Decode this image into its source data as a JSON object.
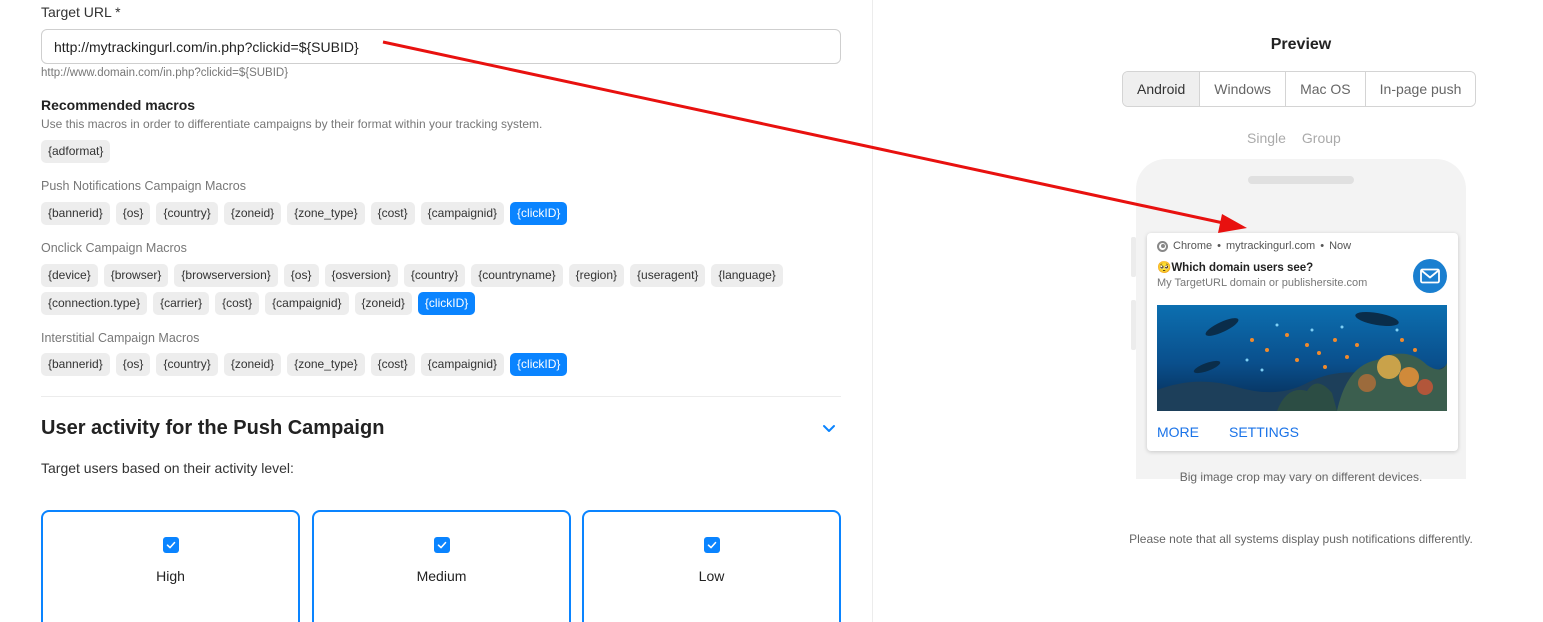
{
  "target_url": {
    "label": "Target URL *",
    "value": "http://mytrackingurl.com/in.php?clickid=${SUBID}",
    "hint": "http://www.domain.com/in.php?clickid=${SUBID}"
  },
  "recommended": {
    "title": "Recommended macros",
    "description": "Use this macros in order to differentiate campaigns by their format within your tracking system.",
    "chips": [
      "{adformat}"
    ]
  },
  "push_macros": {
    "label": "Push Notifications Campaign Macros",
    "chips": [
      "{bannerid}",
      "{os}",
      "{country}",
      "{zoneid}",
      "{zone_type}",
      "{cost}",
      "{campaignid}",
      "{clickID}"
    ],
    "active": "{clickID}"
  },
  "onclick_macros": {
    "label": "Onclick Campaign Macros",
    "row1": [
      "{device}",
      "{browser}",
      "{browserversion}",
      "{os}",
      "{osversion}",
      "{country}",
      "{countryname}",
      "{region}",
      "{useragent}",
      "{language}"
    ],
    "row2": [
      "{connection.type}",
      "{carrier}",
      "{cost}",
      "{campaignid}",
      "{zoneid}",
      "{clickID}"
    ],
    "active": "{clickID}"
  },
  "interstitial_macros": {
    "label": "Interstitial Campaign Macros",
    "chips": [
      "{bannerid}",
      "{os}",
      "{country}",
      "{zoneid}",
      "{zone_type}",
      "{cost}",
      "{campaignid}",
      "{clickID}"
    ],
    "active": "{clickID}"
  },
  "activity": {
    "title": "User activity for the Push Campaign",
    "subtitle": "Target users based on their activity level:",
    "levels": [
      {
        "label": "High",
        "checked": true
      },
      {
        "label": "Medium",
        "checked": true
      },
      {
        "label": "Low",
        "checked": true
      }
    ]
  },
  "preview": {
    "title": "Preview",
    "tabs": [
      "Android",
      "Windows",
      "Mac OS",
      "In-page push"
    ],
    "active_tab": "Android",
    "sub_tabs": [
      "Single",
      "Group"
    ],
    "notification": {
      "browser": "Chrome",
      "domain": "mytrackingurl.com",
      "time": "Now",
      "separator": "•",
      "emoji": "🥺",
      "title": "Which domain users see?",
      "body": "My TargetURL domain or publishersite.com",
      "actions": [
        "MORE",
        "SETTINGS"
      ]
    },
    "crop_note": "Big image crop may vary on different devices.",
    "systems_note": "Please note that all systems display push notifications differently."
  },
  "colors": {
    "accent": "#0a84ff",
    "annotation_arrow": "#e8110f"
  }
}
